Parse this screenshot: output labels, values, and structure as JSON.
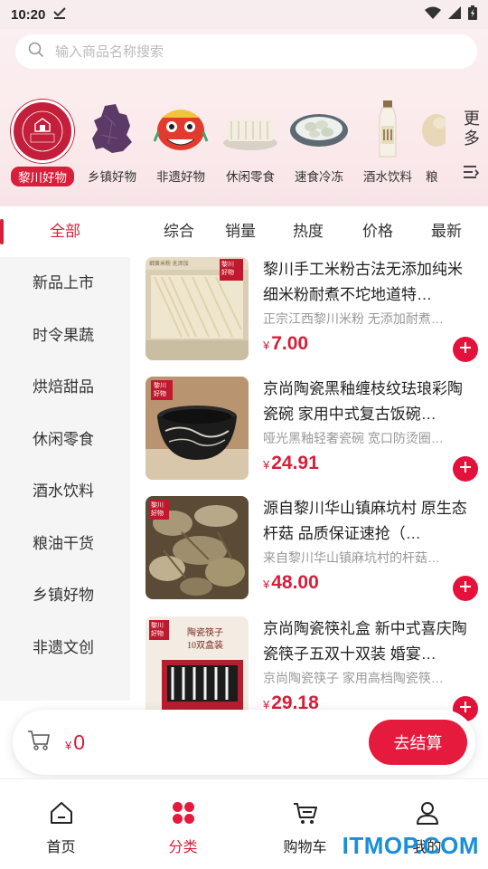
{
  "status_bar": {
    "time": "10:20"
  },
  "search": {
    "placeholder": "输入商品名称搜索"
  },
  "categories": [
    {
      "label": "黎川好物",
      "icon": "lichuan-logo-icon",
      "active": true
    },
    {
      "label": "乡镇好物",
      "icon": "map-region-icon"
    },
    {
      "label": "非遗好物",
      "icon": "lion-head-icon"
    },
    {
      "label": "休闲零食",
      "icon": "snack-icon"
    },
    {
      "label": "速食冷冻",
      "icon": "dumpling-plate-icon"
    },
    {
      "label": "酒水饮料",
      "icon": "bottle-icon"
    },
    {
      "label": "粮",
      "icon": "grain-icon"
    }
  ],
  "more": {
    "label": "更多"
  },
  "tabs": {
    "all": "全部",
    "sort": [
      "综合",
      "销量",
      "热度",
      "价格",
      "最新"
    ]
  },
  "side_list": [
    "新品上市",
    "时令果蔬",
    "烘焙甜品",
    "休闲零食",
    "酒水饮料",
    "粮油干货",
    "乡镇好物",
    "非遗文创"
  ],
  "products": [
    {
      "title": "黎川手工米粉古法无添加纯米细米粉耐煮不坨地道特…",
      "desc": "正宗江西黎川米粉 无添加耐煮…",
      "price": "7.00",
      "image": "rice-noodle-image"
    },
    {
      "title": "京尚陶瓷黑釉缠枝纹珐琅彩陶瓷碗 家用中式复古饭碗…",
      "desc": "哑光黑釉轻奢瓷碗 宽口防烫圈…",
      "price": "24.91",
      "image": "black-bowl-image"
    },
    {
      "title": "源自黎川华山镇麻坑村 原生态杆菇 品质保证速抢（…",
      "desc": "来自黎川华山镇麻坑村的杆菇…",
      "price": "48.00",
      "image": "mushroom-image"
    },
    {
      "title": "京尚陶瓷筷礼盒 新中式喜庆陶瓷筷子五双十双装 婚宴…",
      "desc": "京尚陶瓷筷子 家用高档陶瓷筷…",
      "price": "29.18",
      "image": "chopsticks-box-image"
    }
  ],
  "product_badge": {
    "line1": "黎川",
    "line2": "好物"
  },
  "product_image_text": {
    "noodle_tag": "细黄米粉 无添加",
    "chopsticks_line1": "陶瓷筷子",
    "chopsticks_line2": "10双盒装"
  },
  "currency": "¥",
  "cart": {
    "amount": "0",
    "checkout_label": "去结算"
  },
  "bottom_nav": [
    {
      "label": "首页",
      "icon": "home-icon"
    },
    {
      "label": "分类",
      "icon": "category-grid-icon",
      "active": true
    },
    {
      "label": "购物车",
      "icon": "cart-icon"
    },
    {
      "label": "我的",
      "icon": "user-icon"
    }
  ],
  "watermark": "ITMOP.COM",
  "colors": {
    "accent": "#d81e3b",
    "brand_red": "#c41f3a",
    "watermark": "#1a8ed8"
  }
}
